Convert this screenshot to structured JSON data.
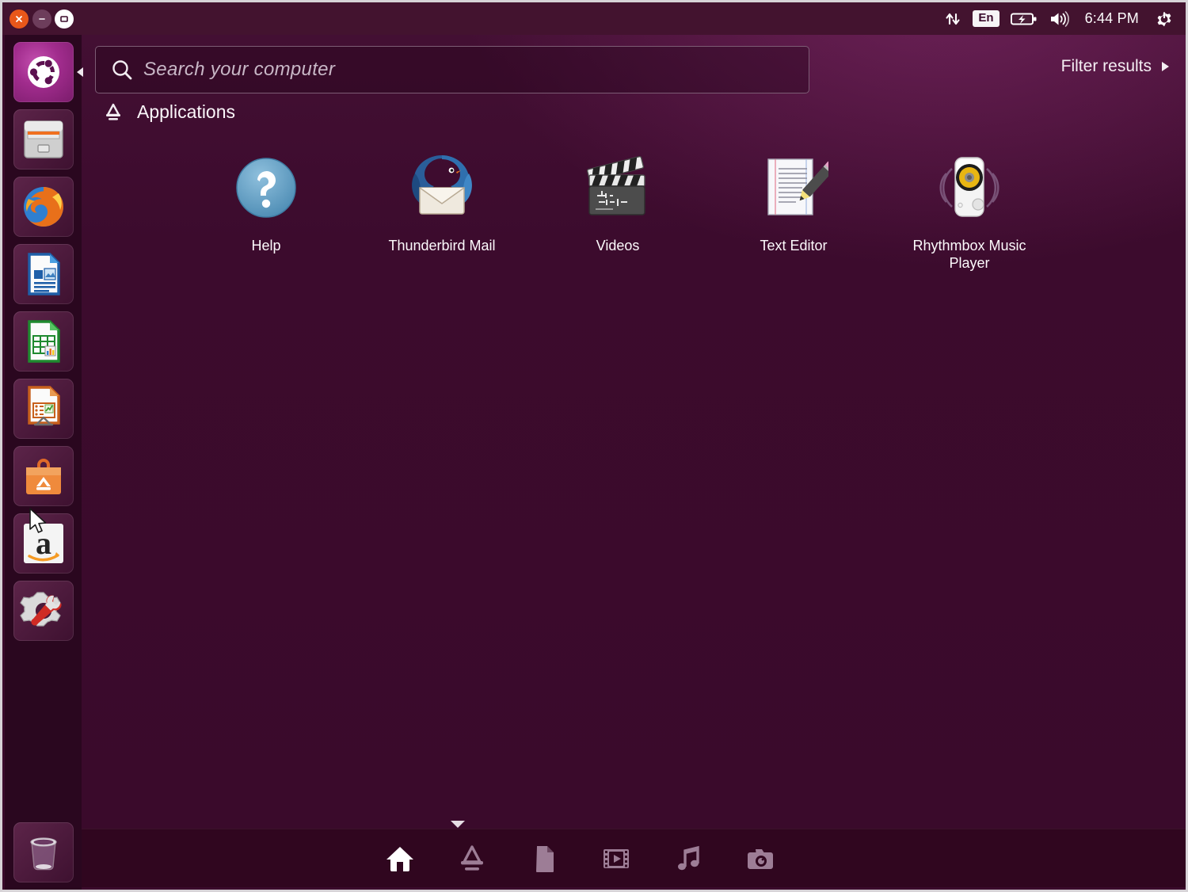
{
  "window": {
    "controls": [
      {
        "name": "close",
        "icon": "close-icon",
        "color": "#e8571a"
      },
      {
        "name": "minimize",
        "icon": "minimize-icon",
        "color": "#6d3d5b"
      },
      {
        "name": "maximize",
        "icon": "maximize-icon",
        "color": "#ffffff"
      }
    ]
  },
  "panel": {
    "background": "#43132f",
    "indicators": [
      {
        "name": "network-indicator",
        "icon": "network-arrows-icon"
      },
      {
        "name": "keyboard-indicator",
        "icon": "keyboard-icon",
        "label": "En"
      },
      {
        "name": "battery-indicator",
        "icon": "battery-charging-icon"
      },
      {
        "name": "sound-indicator",
        "icon": "volume-icon"
      }
    ],
    "clock": "6:44 PM",
    "session": {
      "name": "session-indicator",
      "icon": "gear-power-icon"
    }
  },
  "launcher": {
    "background": "#210519",
    "bfb": {
      "label": "Ubuntu",
      "icon": "ubuntu-logo-icon"
    },
    "items": [
      {
        "label": "Files",
        "icon": "files-cabinet-icon"
      },
      {
        "label": "Firefox Web Browser",
        "icon": "firefox-icon"
      },
      {
        "label": "LibreOffice Writer",
        "icon": "libreoffice-writer-icon"
      },
      {
        "label": "LibreOffice Calc",
        "icon": "libreoffice-calc-icon"
      },
      {
        "label": "LibreOffice Impress",
        "icon": "libreoffice-impress-icon"
      },
      {
        "label": "Ubuntu Software Center",
        "icon": "software-center-icon"
      },
      {
        "label": "Amazon",
        "icon": "amazon-icon"
      },
      {
        "label": "System Settings",
        "icon": "system-settings-icon"
      }
    ],
    "trash": {
      "label": "Trash",
      "icon": "trash-icon"
    }
  },
  "dash": {
    "background": "#3c0b2d",
    "search": {
      "placeholder": "Search your computer",
      "value": "",
      "icon": "search-icon"
    },
    "filter": {
      "label": "Filter results",
      "icon": "chevron-right-icon"
    },
    "category": {
      "title": "Applications",
      "icon": "applications-lens-icon"
    },
    "results": [
      {
        "label": "Help",
        "icon": "help-icon"
      },
      {
        "label": "Thunderbird Mail",
        "icon": "thunderbird-icon"
      },
      {
        "label": "Videos",
        "icon": "videos-clapperboard-icon"
      },
      {
        "label": "Text Editor",
        "icon": "text-editor-icon"
      },
      {
        "label": "Rhythmbox Music Player",
        "icon": "rhythmbox-icon"
      }
    ],
    "lenses": [
      {
        "label": "Home",
        "icon": "home-lens-icon",
        "active": true
      },
      {
        "label": "Applications",
        "icon": "applications-lens-icon",
        "active": false
      },
      {
        "label": "Files & Folders",
        "icon": "files-lens-icon",
        "active": false
      },
      {
        "label": "Video",
        "icon": "video-lens-icon",
        "active": false
      },
      {
        "label": "Music",
        "icon": "music-lens-icon",
        "active": false
      },
      {
        "label": "Photos",
        "icon": "photos-lens-icon",
        "active": false
      }
    ]
  }
}
